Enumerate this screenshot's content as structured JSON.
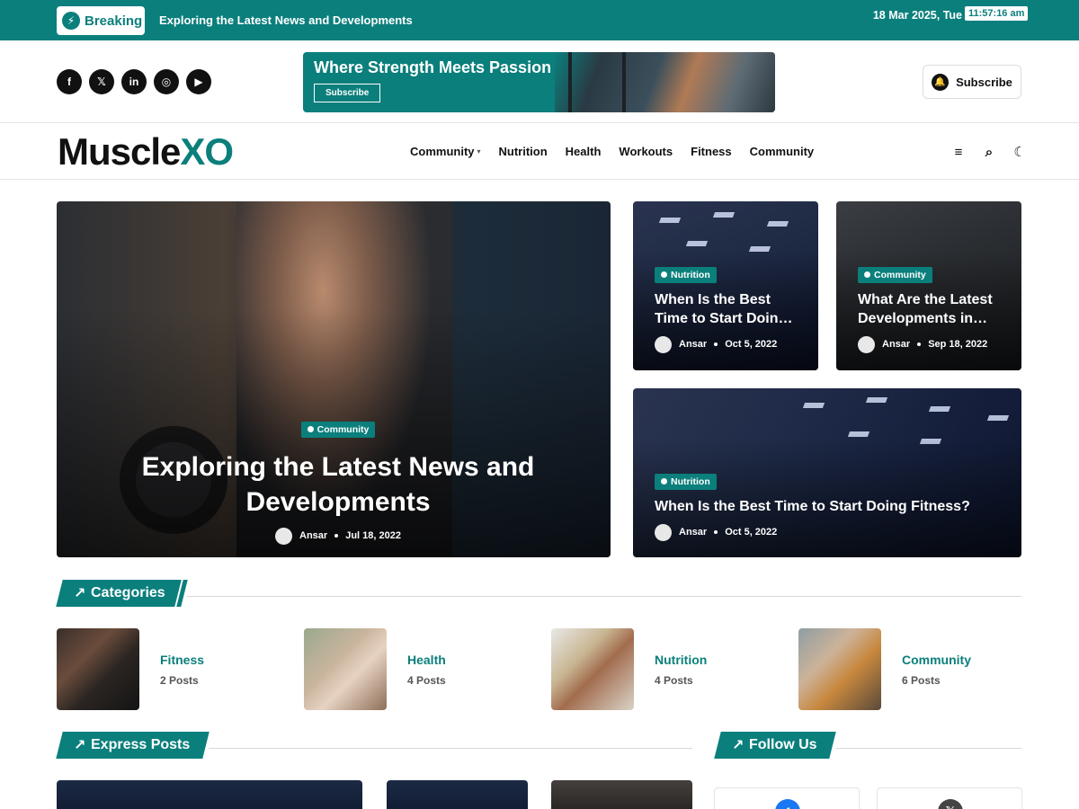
{
  "topbar": {
    "breaking_label": "Breaking",
    "breaking_text": "Exploring the Latest News and Developments",
    "date": "18 Mar 2025, Tue",
    "time": "11:57:16 am"
  },
  "social_icons": [
    "facebook-icon",
    "x-icon",
    "linkedin-icon",
    "instagram-icon",
    "youtube-icon"
  ],
  "banner": {
    "headline": "Where Strength Meets Passion",
    "cta": "Subscribe"
  },
  "header": {
    "subscribe_label": "Subscribe"
  },
  "logo": {
    "main": "Muscle",
    "accent": "XO"
  },
  "nav": {
    "items": [
      "Community",
      "Nutrition",
      "Health",
      "Workouts",
      "Fitness",
      "Community"
    ]
  },
  "hero": {
    "tag": "Community",
    "title": "Exploring the Latest News and Developments",
    "author": "Ansar",
    "date": "Jul 18, 2022"
  },
  "side_posts": [
    {
      "tag": "Nutrition",
      "title": "When Is the Best Time to Start Doin…",
      "author": "Ansar",
      "date": "Oct 5, 2022"
    },
    {
      "tag": "Community",
      "title": "What Are the Latest Developments in…",
      "author": "Ansar",
      "date": "Sep 18, 2022"
    },
    {
      "tag": "Nutrition",
      "title": "When Is the Best Time to Start Doing Fitness?",
      "author": "Ansar",
      "date": "Oct 5, 2022"
    }
  ],
  "sections": {
    "categories": "Categories",
    "express": "Express Posts",
    "follow": "Follow Us"
  },
  "categories": [
    {
      "name": "Fitness",
      "count": "2 Posts"
    },
    {
      "name": "Health",
      "count": "4 Posts"
    },
    {
      "name": "Nutrition",
      "count": "4 Posts"
    },
    {
      "name": "Community",
      "count": "6 Posts"
    }
  ],
  "colors": {
    "accent": "#0b7f7c",
    "text": "#111111"
  }
}
